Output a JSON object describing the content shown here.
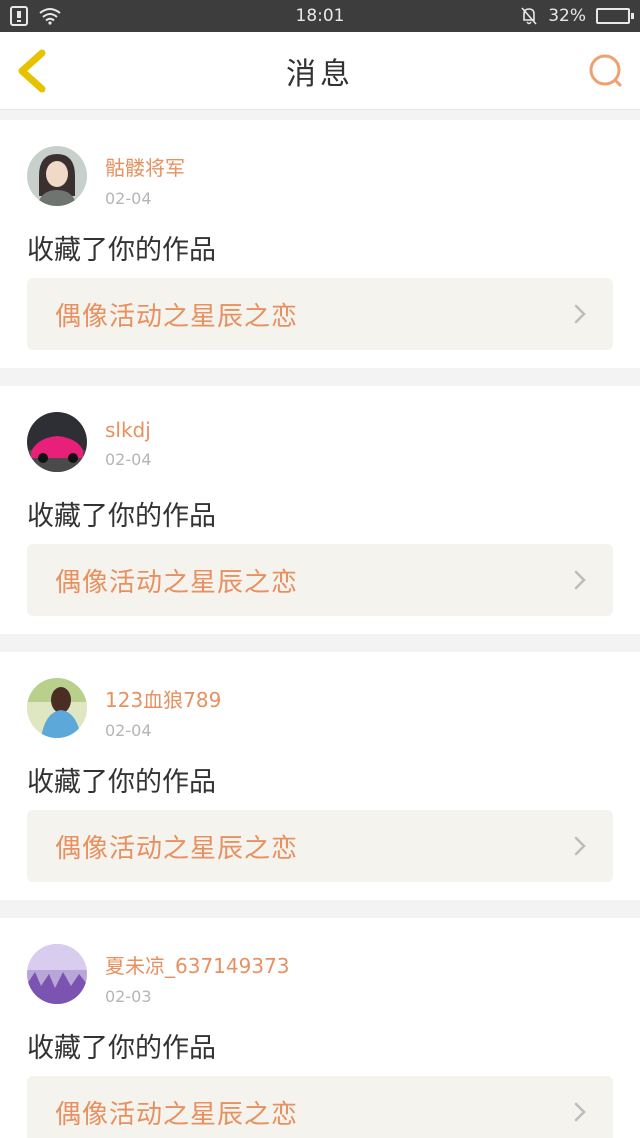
{
  "status_bar": {
    "time": "18:01",
    "battery": "32%",
    "battery_level": 0.32
  },
  "header": {
    "title": "消息"
  },
  "messages": [
    {
      "username": "骷髅将军",
      "date": "02-04",
      "action": "收藏了你的作品",
      "work": "偶像活动之星辰之恋"
    },
    {
      "username": "slkdj",
      "date": "02-04",
      "action": "收藏了你的作品",
      "work": "偶像活动之星辰之恋"
    },
    {
      "username": "123血狼789",
      "date": "02-04",
      "action": "收藏了你的作品",
      "work": "偶像活动之星辰之恋"
    },
    {
      "username": "夏未凉_637149373",
      "date": "02-03",
      "action": "收藏了你的作品",
      "work": "偶像活动之星辰之恋"
    }
  ],
  "colors": {
    "accent": "#e8905f",
    "back_icon": "#e6c200",
    "card_bg": "#f4f3ee"
  },
  "icons": {
    "back": "chevron-left-icon",
    "search": "search-icon",
    "work_arrow": "chevron-right-icon"
  }
}
